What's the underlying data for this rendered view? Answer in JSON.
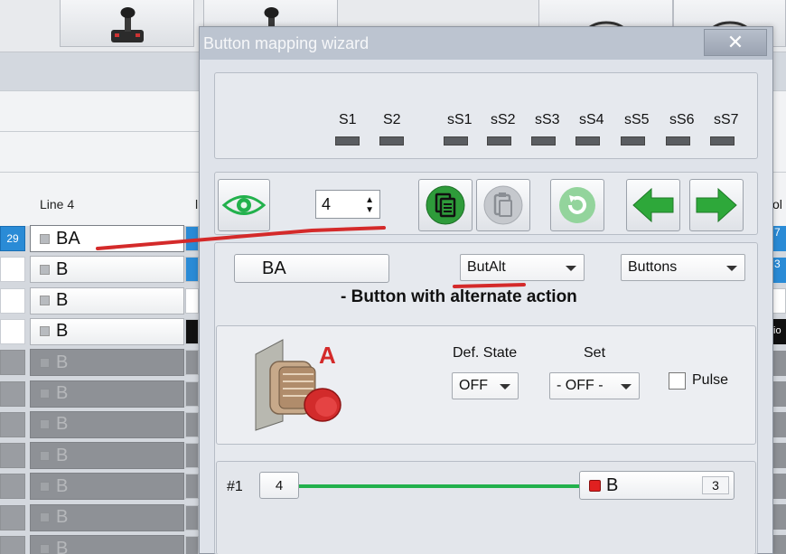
{
  "background": {
    "column_header": "Line 4",
    "column_header_partial": "l",
    "rows": [
      {
        "left": "29",
        "label": "BA",
        "state": "selected",
        "trail": "blue"
      },
      {
        "left": "",
        "label": "B",
        "state": "normal",
        "trail": "blue"
      },
      {
        "left": "",
        "label": "B",
        "state": "normal",
        "trail": "white"
      },
      {
        "left": "",
        "label": "B",
        "state": "normal",
        "trail": "black"
      },
      {
        "left": "",
        "label": "B",
        "state": "disabled",
        "trail": "dis"
      },
      {
        "left": "",
        "label": "B",
        "state": "disabled",
        "trail": "dis"
      },
      {
        "left": "",
        "label": "B",
        "state": "disabled",
        "trail": "dis"
      },
      {
        "left": "",
        "label": "B",
        "state": "disabled",
        "trail": "dis"
      },
      {
        "left": "",
        "label": "B",
        "state": "disabled",
        "trail": "dis"
      },
      {
        "left": "",
        "label": "B",
        "state": "disabled",
        "trail": "dis"
      },
      {
        "left": "",
        "label": "B",
        "state": "disabled",
        "trail": "dis"
      }
    ],
    "right_column": {
      "header": "ol",
      "cells": [
        "7",
        "3",
        "",
        "tio"
      ]
    }
  },
  "dialog": {
    "title": "Button mapping wizard",
    "close_glyph": "✕",
    "switches": [
      "S1",
      "S2",
      "sS1",
      "sS2",
      "sS3",
      "sS4",
      "sS5",
      "sS6",
      "sS7"
    ],
    "number_value": "4",
    "button_name": "BA",
    "type_select": "ButAlt",
    "category_select": "Buttons",
    "description": "- Button with alternate action",
    "def_state_label": "Def. State",
    "set_label": "Set",
    "def_state_value": "OFF",
    "set_value": "- OFF -",
    "pulse_label": "Pulse",
    "pulse_checked": false,
    "image_letter": "A",
    "mapping": {
      "index_label": "#1",
      "source_value": "4",
      "target_label": "B",
      "target_value": "3"
    }
  },
  "colors": {
    "eye_green": "#22b14c",
    "arrow_green": "#2ea83a",
    "annotation_red": "#d42a2a",
    "selection_blue": "#2a8bd6"
  }
}
